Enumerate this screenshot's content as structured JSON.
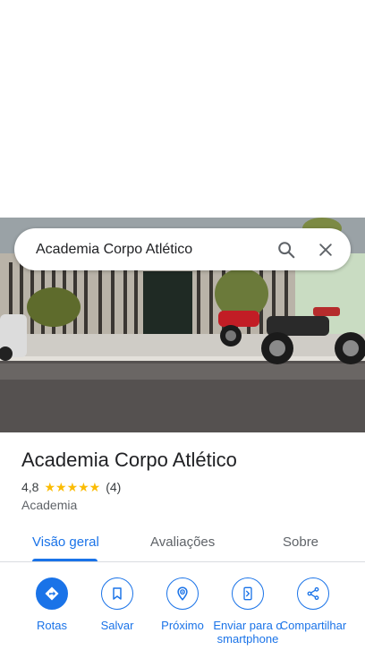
{
  "search": {
    "query": "Academia Corpo Atlético",
    "search_icon": "search-icon",
    "close_icon": "close-icon"
  },
  "place": {
    "name": "Academia Corpo Atlético",
    "rating": "4,8",
    "stars": "★★★★★",
    "review_count": "(4)",
    "category": "Academia"
  },
  "tabs": [
    {
      "label": "Visão geral",
      "active": true
    },
    {
      "label": "Avaliações",
      "active": false
    },
    {
      "label": "Sobre",
      "active": false
    }
  ],
  "actions": [
    {
      "label": "Rotas",
      "icon": "directions-icon"
    },
    {
      "label": "Salvar",
      "icon": "bookmark-icon"
    },
    {
      "label": "Próximo",
      "icon": "nearby-icon"
    },
    {
      "label": "Enviar para o smartphone",
      "icon": "send-to-phone-icon"
    },
    {
      "label": "Compartilhar",
      "icon": "share-icon"
    }
  ],
  "colors": {
    "accent": "#1a73e8",
    "star": "#fbbc04",
    "text": "#202124",
    "secondary_text": "#5f6368"
  }
}
